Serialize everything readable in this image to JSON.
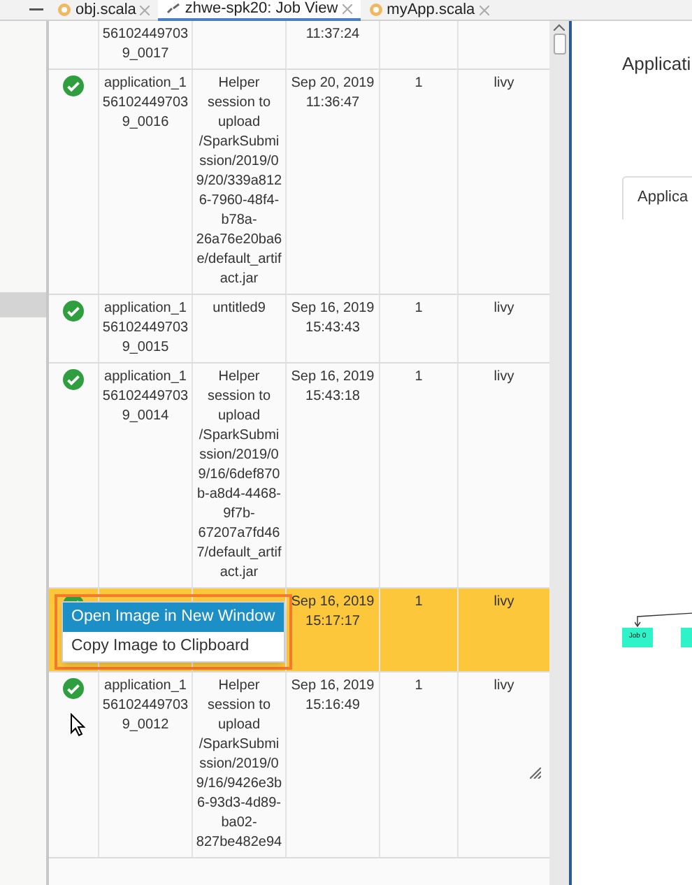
{
  "tabs": [
    {
      "label": "obj.scala",
      "kind": "scala",
      "selected": false
    },
    {
      "label": "zhwe-spk20: Job View",
      "kind": "job",
      "selected": true
    },
    {
      "label": "myApp.scala",
      "kind": "scala",
      "selected": false
    }
  ],
  "rows": [
    {
      "selected": false,
      "app": "56102449703 9_0017",
      "name": "",
      "time": "11:37:24",
      "count": "",
      "user": ""
    },
    {
      "succeeded": true,
      "selected": false,
      "app": "application_1561024497039_0016",
      "name": "Helper session to upload /SparkSubmission/2019/09/20/339a8126-7960-48f4-b78a-26a76e20ba6e/default_artifact.jar",
      "time": "Sep 20, 2019 11:36:47",
      "count": "1",
      "user": "livy"
    },
    {
      "succeeded": true,
      "selected": false,
      "app": "application_1561024497039_0015",
      "name": "untitled9",
      "time": "Sep 16, 2019 15:43:43",
      "count": "1",
      "user": "livy"
    },
    {
      "succeeded": true,
      "selected": false,
      "app": "application_1561024497039_0014",
      "name": "Helper session to upload /SparkSubmission/2019/09/16/6def870b-a8d4-4468-9f7b-67207a7fd467/default_artifact.jar",
      "time": "Sep 16, 2019 15:43:18",
      "count": "1",
      "user": "livy"
    },
    {
      "succeeded": true,
      "selected": true,
      "app": "",
      "name": "",
      "time": "Sep 16, 2019 15:17:17",
      "count": "1",
      "user": "livy"
    },
    {
      "succeeded": true,
      "selected": false,
      "app": "application_1561024497039_0012",
      "name": "Helper session to upload /SparkSubmission/2019/09/16/9426e3b6-93d3-4d89-ba02-827be482e94",
      "time": "Sep 16, 2019 15:16:49",
      "count": "1",
      "user": "livy"
    }
  ],
  "context_menu": {
    "items": [
      {
        "label": "Open Image in New Window",
        "selected": true
      },
      {
        "label": "Copy Image to Clipboard",
        "selected": false
      }
    ]
  },
  "right_panel": {
    "title": "Applicati",
    "tab": "Applica",
    "nodes": [
      "Job 0"
    ]
  }
}
